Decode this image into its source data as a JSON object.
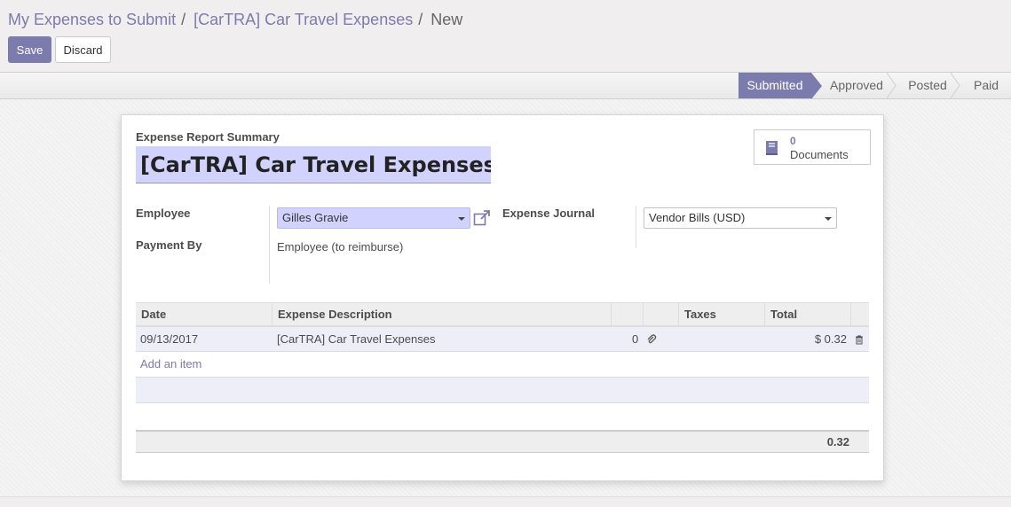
{
  "breadcrumb": {
    "item1": "My Expenses to Submit",
    "item2": "[CarTRA] Car Travel Expenses",
    "current": "New",
    "separator": "/"
  },
  "buttons": {
    "save": "Save",
    "discard": "Discard"
  },
  "statusbar": {
    "stages": [
      "Submitted",
      "Approved",
      "Posted",
      "Paid"
    ],
    "active": "Submitted"
  },
  "form": {
    "summary_label": "Expense Report Summary",
    "title_value": "[CarTRA] Car Travel Expenses",
    "documents": {
      "count": "0",
      "label": "Documents",
      "icon": "book-icon"
    },
    "employee_label": "Employee",
    "employee_value": "Gilles Gravie",
    "payment_by_label": "Payment By",
    "payment_by_value": "Employee (to reimburse)",
    "journal_label": "Expense Journal",
    "journal_value": "Vendor Bills (USD)"
  },
  "table": {
    "columns": [
      "Date",
      "Expense Description",
      "",
      "",
      "Taxes",
      "Total"
    ],
    "rows": [
      {
        "date": "09/13/2017",
        "description": "[CarTRA] Car Travel Expenses",
        "attachments": "0",
        "taxes": "",
        "total": "$ 0.32"
      }
    ],
    "add_item": "Add an item",
    "footer_total": "0.32"
  },
  "colors": {
    "accent": "#7c7bad",
    "highlight_field": "#d2d2ff",
    "row_bg": "#eeeef9"
  }
}
